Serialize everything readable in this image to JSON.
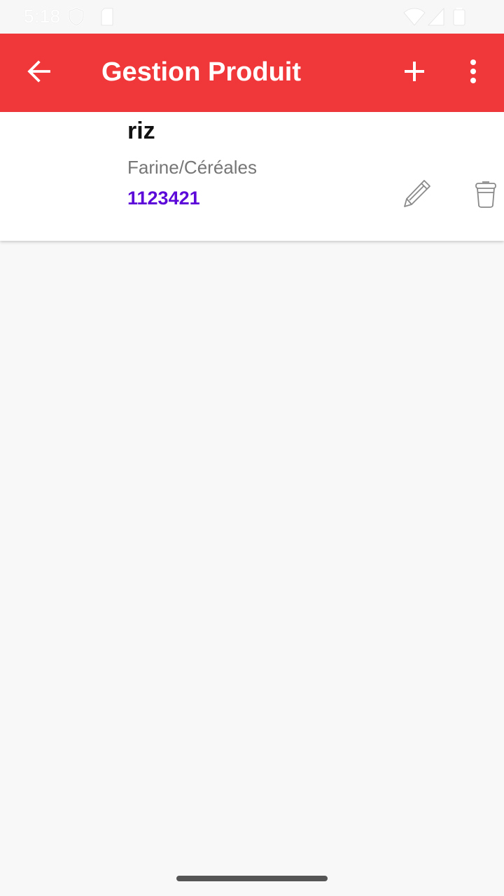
{
  "status_bar": {
    "time": "5:18",
    "icons": [
      "shield-icon",
      "sim-card-icon",
      "wifi-icon",
      "cellular-signal-icon",
      "battery-icon"
    ]
  },
  "app_bar": {
    "title": "Gestion Produit",
    "background_color": "#f0383b",
    "icons": [
      "back-arrow-icon",
      "plus-icon",
      "more-vertical-icon"
    ]
  },
  "products": [
    {
      "name": "riz",
      "category": "Farine/Céréales",
      "code": "1123421",
      "code_color": "#5b08d9",
      "actions": [
        "pencil-icon",
        "trash-icon"
      ]
    }
  ]
}
